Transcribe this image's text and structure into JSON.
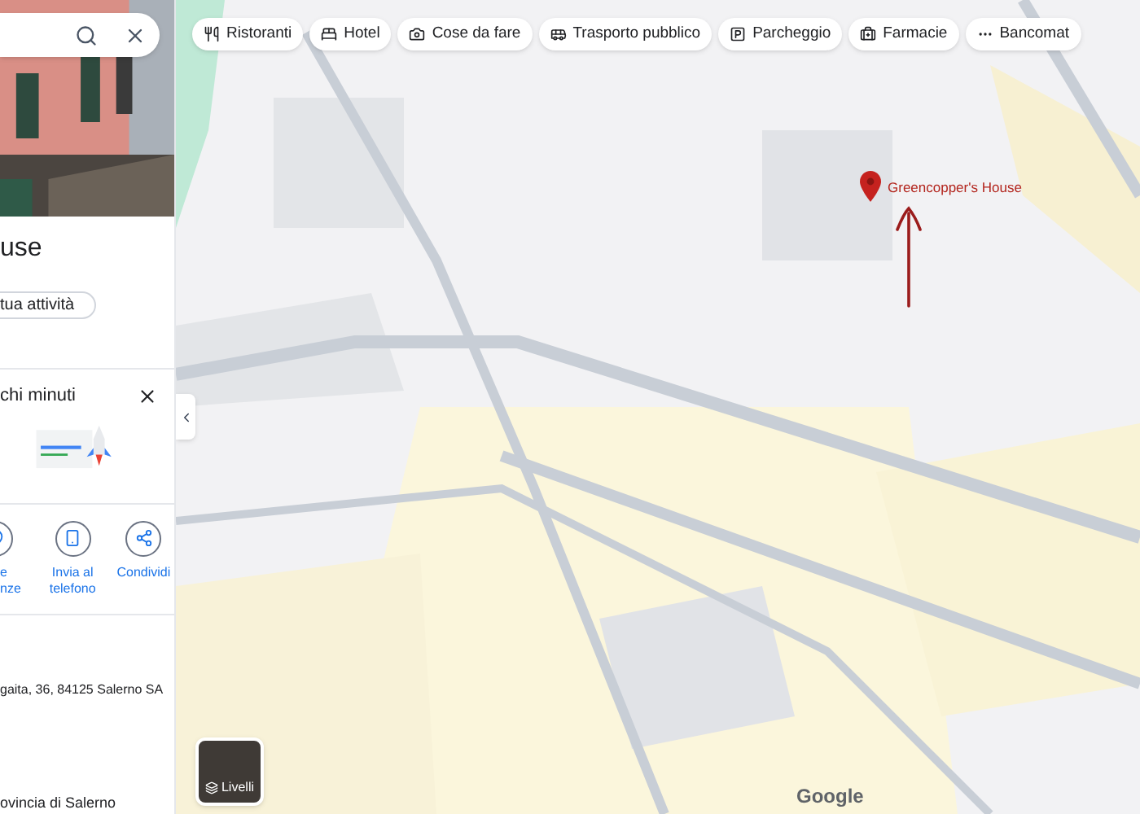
{
  "place_panel": {
    "title": "use",
    "claim_button": "tua attività",
    "promo": {
      "title": "chi minuti"
    },
    "actions": [
      {
        "label": "e\nnze"
      },
      {
        "label": "Invia al\ntelefono"
      },
      {
        "label": "Condividi"
      }
    ],
    "address": "gaita, 36, 84125 Salerno SA",
    "region": "ovincia di Salerno"
  },
  "filter_chips": [
    {
      "label": "Ristoranti"
    },
    {
      "label": "Hotel"
    },
    {
      "label": "Cose da fare"
    },
    {
      "label": "Trasporto pubblico"
    },
    {
      "label": "Parcheggio"
    },
    {
      "label": "Farmacie"
    },
    {
      "label": "Bancomat"
    }
  ],
  "map": {
    "marker_label": "Greencopper's House",
    "layers_button": "Livelli",
    "logo": "Google"
  }
}
